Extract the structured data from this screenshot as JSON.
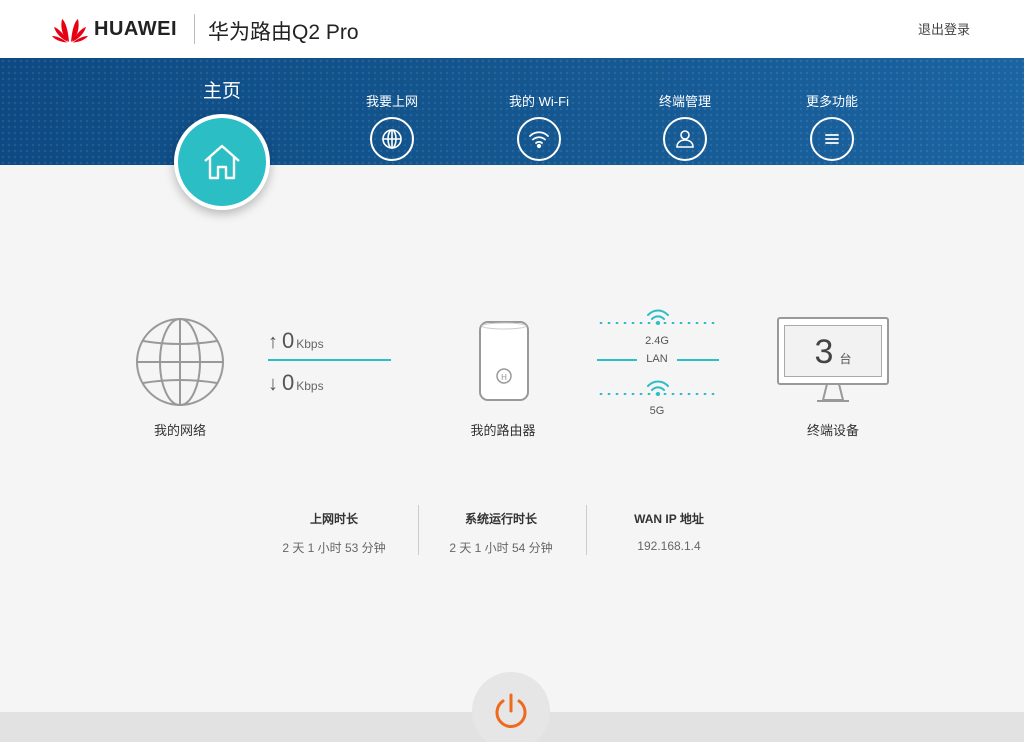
{
  "header": {
    "brand": "HUAWEI",
    "product": "华为路由Q2 Pro",
    "logout": "退出登录",
    "logo_color": "#e60012"
  },
  "nav": {
    "home": {
      "label": "主页",
      "icon": "home-icon"
    },
    "items": [
      {
        "label": "我要上网",
        "icon": "globe-icon"
      },
      {
        "label": "我的 Wi-Fi",
        "icon": "wifi-icon"
      },
      {
        "label": "终端管理",
        "icon": "user-icon"
      },
      {
        "label": "更多功能",
        "icon": "menu-icon"
      }
    ],
    "accent": "#2bbec5"
  },
  "topology": {
    "network_label": "我的网络",
    "upload": {
      "value": "0",
      "unit": "Kbps"
    },
    "download": {
      "value": "0",
      "unit": "Kbps"
    },
    "router_label": "我的路由器",
    "bands": {
      "band_24": "2.4G",
      "lan": "LAN",
      "band_5": "5G"
    },
    "devices": {
      "count": "3",
      "unit": "台",
      "label": "终端设备"
    }
  },
  "stats": [
    {
      "title": "上网时长",
      "value": "2 天 1 小时 53 分钟"
    },
    {
      "title": "系统运行时长",
      "value": "2 天 1 小时 54 分钟"
    },
    {
      "title": "WAN IP 地址",
      "value": "192.168.1.4"
    }
  ],
  "power": {
    "icon": "power-icon",
    "color": "#ee6a1f"
  }
}
